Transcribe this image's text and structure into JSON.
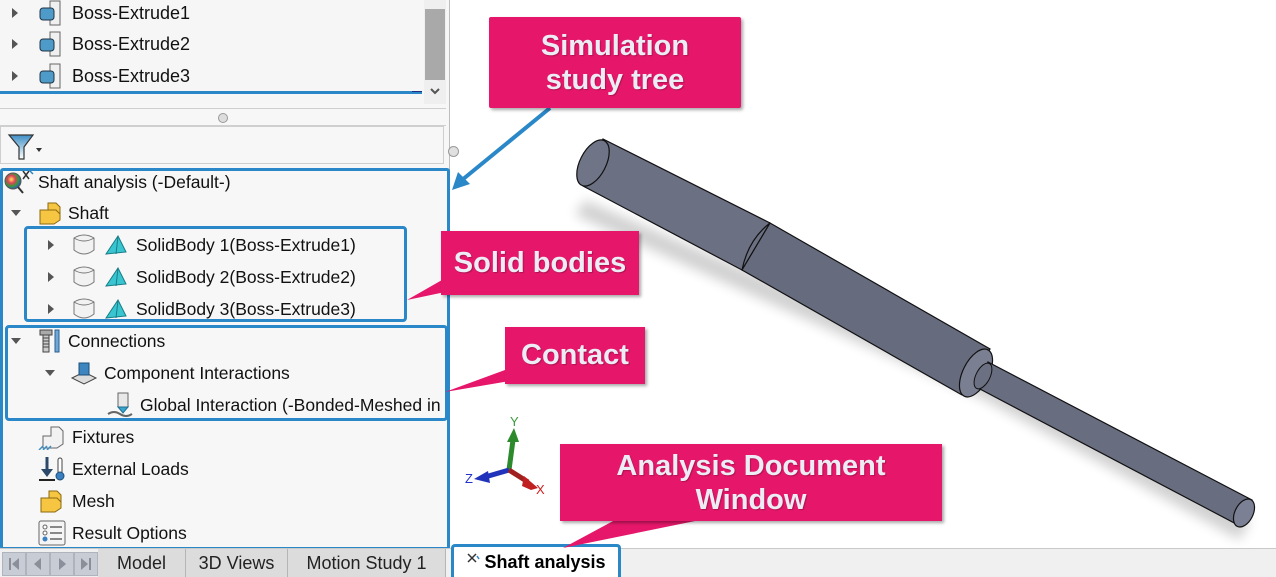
{
  "feature_tree": {
    "items": [
      {
        "label": "Boss-Extrude1",
        "icon": "boss-extrude-icon"
      },
      {
        "label": "Boss-Extrude2",
        "icon": "boss-extrude-icon"
      },
      {
        "label": "Boss-Extrude3",
        "icon": "boss-extrude-icon"
      }
    ]
  },
  "filter": {
    "icon": "filter-icon"
  },
  "simulation_tree": {
    "root": "Shaft analysis (-Default-)",
    "part": "Shaft",
    "solid_bodies": [
      "SolidBody 1(Boss-Extrude1)",
      "SolidBody 2(Boss-Extrude2)",
      "SolidBody 3(Boss-Extrude3)"
    ],
    "connections": "Connections",
    "component_interactions": "Component Interactions",
    "global_interaction": "Global Interaction (-Bonded-Meshed in",
    "fixtures": "Fixtures",
    "external_loads": "External Loads",
    "mesh": "Mesh",
    "result_options": "Result Options"
  },
  "tabs": {
    "items": [
      "Model",
      "3D Views",
      "Motion Study 1",
      "Shaft analysis"
    ],
    "active": "Shaft analysis"
  },
  "triad": {
    "x": "X",
    "y": "Y",
    "z": "Z"
  },
  "callouts": {
    "simulation_tree": [
      "Simulation",
      "study tree"
    ],
    "solid_bodies": "Solid bodies",
    "contact": "Contact",
    "analysis_window": [
      "Analysis Document",
      "Window"
    ]
  },
  "colors": {
    "callout": "#e6176a",
    "highlight": "#2a87c8",
    "shaft": "#6f7384"
  }
}
